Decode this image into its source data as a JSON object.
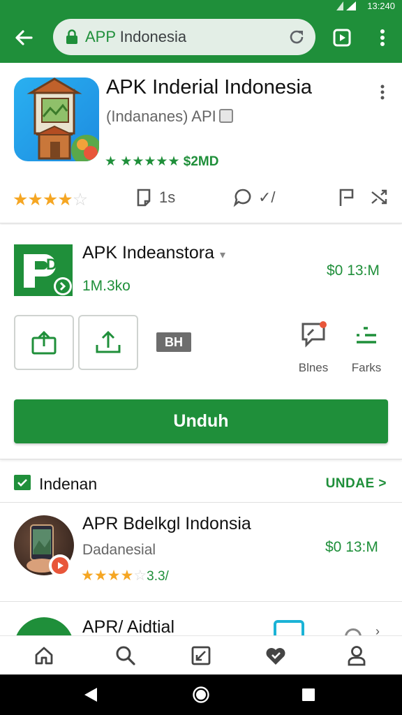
{
  "colors": {
    "brand": "#1f8f3a",
    "star": "#f5a623",
    "text": "#202124"
  },
  "status_bar": {
    "time": "13:240"
  },
  "browser": {
    "url_prefix": "APP",
    "url_rest": " Indonesia",
    "icons": [
      "back-arrow-icon",
      "lock-icon",
      "reload-icon",
      "tabs-icon",
      "more-vert-icon"
    ]
  },
  "app": {
    "title": "APK Inderial Indonesia",
    "subtitle": "(Indananes) API",
    "rating_text": "★ ★★★★★ $2MD",
    "stars": {
      "value": 4,
      "max": 5
    },
    "meta": {
      "pages_label": "1s",
      "chat_label": "✓/"
    }
  },
  "section2": {
    "name": "APK Indeanstora",
    "size": "1M.3ko",
    "price": "$0 13:M",
    "chip": "BH",
    "side_actions": [
      {
        "label": "Blnes",
        "icon": "report-icon"
      },
      {
        "label": "Farks",
        "icon": "list-icon"
      }
    ],
    "download_label": "Unduh"
  },
  "section3": {
    "title": "Indenan",
    "more_label": "UNDAE >"
  },
  "list": [
    {
      "name": "APR Bdelkgl Indonsia",
      "subtitle": "Dadanesial",
      "rating_text": "3.3/",
      "stars": {
        "value": 4.5,
        "max": 5
      },
      "price": "$0 13:M"
    },
    {
      "name": "APR/ Aidtial"
    }
  ],
  "bottom_nav": [
    "home-icon",
    "search-icon",
    "editor-icon",
    "favorites-icon",
    "profile-icon"
  ],
  "system_nav": [
    "back-icon",
    "home-circle-icon",
    "recents-icon"
  ]
}
